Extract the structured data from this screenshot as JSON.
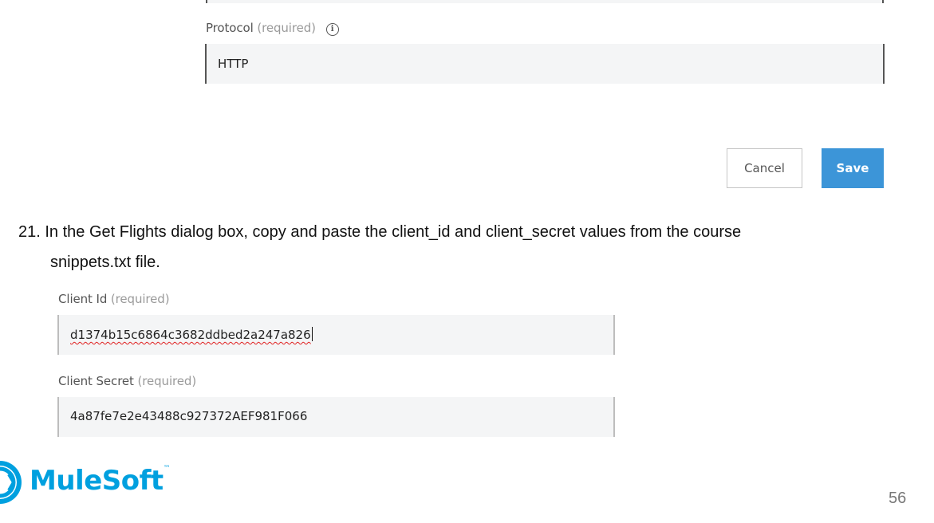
{
  "protocol": {
    "label": "Protocol",
    "required": "(required)",
    "info_icon": "info-icon",
    "value": "HTTP"
  },
  "actions": {
    "cancel_label": "Cancel",
    "save_label": "Save"
  },
  "instruction": {
    "number": "21.",
    "line1": "In the Get Flights dialog box, copy and paste the client_id and client_secret values from the course",
    "line2": "snippets.txt file."
  },
  "client_id": {
    "label": "Client Id",
    "required": "(required)",
    "value": "d1374b15c6864c3682ddbed2a247a826"
  },
  "client_secret": {
    "label": "Client Secret",
    "required": "(required)",
    "value": "4a87fe7e2e43488c927372AEF981F066"
  },
  "footer": {
    "logo_text": "MuleSoft",
    "logo_tm": "™",
    "page_number": "56"
  },
  "colors": {
    "accent": "#3c95d8",
    "brand": "#00a0df",
    "field_bg": "#f4f5f6"
  }
}
